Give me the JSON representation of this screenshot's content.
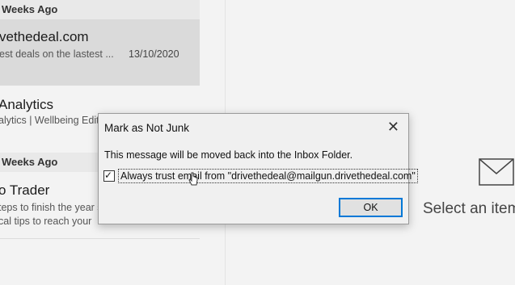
{
  "mail_list": {
    "groups": [
      {
        "header": "Weeks Ago"
      },
      {
        "header": "Weeks Ago"
      }
    ],
    "items": [
      {
        "sender": "vethedeal.com",
        "preview": "est deals on the lastest ...",
        "date": "13/10/2020",
        "selected": true
      },
      {
        "sender": "Analytics",
        "preview": "alytics | Wellbeing Editi",
        "date": ""
      },
      {
        "sender": "o Trader",
        "preview": "teps to finish the year s",
        "preview2": "cal tips to reach your",
        "date": ""
      }
    ]
  },
  "reading_pane": {
    "empty_text": "Select an item",
    "icon": "envelope-icon"
  },
  "dialog": {
    "title": "Mark as Not Junk",
    "close_icon": "close-icon",
    "message": "This message will be moved back into the Inbox Folder.",
    "checkbox_label": "Always trust email from \"drivethedeal@mailgun.drivethedeal.com\"",
    "checkbox_checked": true,
    "ok_label": "OK"
  },
  "colors": {
    "accent": "#0078d7",
    "selected_row": "#dadada",
    "group_header": "#e9e9e9"
  }
}
